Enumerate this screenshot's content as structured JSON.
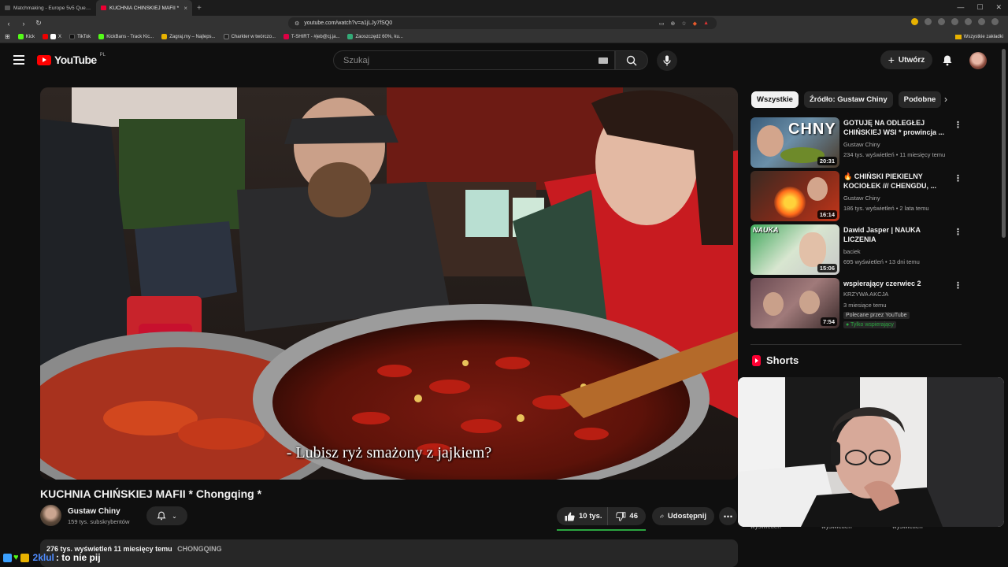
{
  "browser": {
    "tabs": [
      {
        "label": "Matchmaking - Europe 5v5 Queue -",
        "active": false
      },
      {
        "label": "KUCHNIA CHIŃSKIEJ MAFII *",
        "active": true
      }
    ],
    "url": "youtube.com/watch?v=a1jLJy7fSQ0",
    "bookmarks": [
      "Kick",
      "X",
      "TikTok",
      "KickBans - Track Kic...",
      "Zagraj.my – Najleps...",
      "Charkter w twórczo...",
      "T-SHIRT - #jeb@cj.ja...",
      "Zaoszczędź 60%, ku..."
    ],
    "all_bookmarks": "Wszystkie zakładki"
  },
  "youtube": {
    "logo_text": "YouTube",
    "country_code": "PL",
    "search_placeholder": "Szukaj",
    "create_label": "Utwórz"
  },
  "video": {
    "subtitle": "- Lubisz ryż smażony z jajkiem?",
    "title": "KUCHNIA CHIŃSKIEJ MAFII * Chongqing *",
    "channel": "Gustaw Chiny",
    "subscribers": "159 tys. subskrybentów",
    "likes": "10 tys.",
    "dislikes": "46",
    "share_label": "Udostępnij",
    "like_ratio": 1.0,
    "desc_stats": "276 tys. wyświetleń  11 miesięcy temu",
    "desc_tag": "CHONGQING"
  },
  "sidebar": {
    "chips": [
      "Wszystkie",
      "Źródło: Gustaw Chiny",
      "Podobne"
    ],
    "recs": [
      {
        "title": "GOTUJĘ NA ODLEGŁEJ CHIŃSKIEJ WSI * prowincja ...",
        "channel": "Gustaw Chiny",
        "meta": "234 tys. wyświetleń • 11 miesięcy temu",
        "duration": "20:31",
        "thumb_text": "CHNY"
      },
      {
        "title": "🔥 CHIŃSKI PIEKIELNY KOCIOŁEK /// CHENGDU, ...",
        "channel": "Gustaw Chiny",
        "meta": "186 tys. wyświetleń • 2 lata temu",
        "duration": "16:14",
        "thumb_text": ""
      },
      {
        "title": "Dawid Jasper | NAUKA LICZENIA",
        "channel": "baciek",
        "meta": "695 wyświetleń • 13 dni temu",
        "duration": "15:06",
        "thumb_text": "NAUKA"
      },
      {
        "title": "wspierający czerwiec 2",
        "channel": "KRZYWA AKCJA",
        "meta": "3 miesiące temu",
        "duration": "7:54",
        "thumb_text": "",
        "badge1": "Polecane przez YouTube",
        "badge2": "Tylko wspierający"
      }
    ],
    "shorts_label": "Shorts",
    "shorts_meta": [
      "wyświetleń",
      "wyświetleń",
      "wyświetleń"
    ]
  },
  "chat": {
    "user": "2klul",
    "message": ": to nie pij"
  },
  "colors": {
    "accent": "#ff0000",
    "like_bar": "#2ba640",
    "bg": "#0f0f0f"
  }
}
